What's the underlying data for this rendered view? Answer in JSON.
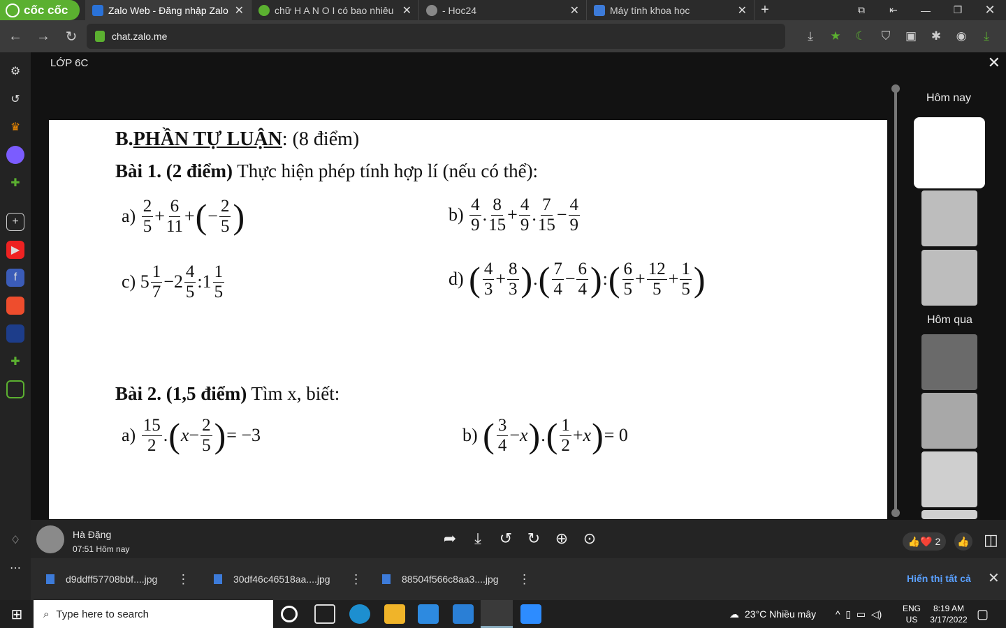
{
  "browser": {
    "brand": "cốc cốc",
    "tabs": [
      {
        "title": "Zalo Web - Đăng nhập Zalo",
        "active": true,
        "icon": "zalo-icon"
      },
      {
        "title": "chữ H A N O I có bao nhiêu",
        "active": false,
        "icon": "hoc24-icon"
      },
      {
        "title": "- Hoc24",
        "active": false,
        "icon": "globe-icon"
      },
      {
        "title": "Máy tính khoa học",
        "active": false,
        "icon": "calculator-icon"
      }
    ],
    "url": "chat.zalo.me"
  },
  "viewer": {
    "title": "LỚP 6C",
    "day_labels": [
      "Hôm nay",
      "Hôm qua"
    ],
    "sender": {
      "name": "Hà Đặng",
      "time": "07:51 Hôm nay"
    },
    "reaction_count": "2"
  },
  "document": {
    "heading_prefix": "B.",
    "heading_main": "PHẦN TỰ LUẬN",
    "heading_suffix": ": (8 điểm)",
    "bai1_label": "Bài 1",
    "bai1_points": ". (2 điểm)",
    "bai1_text": " Thực hiện phép tính hợp lí (nếu có thể):",
    "bai2_label": "Bài 2. (1,5 điểm)",
    "bai2_text": " Tìm x, biết:",
    "labels": {
      "a": "a)",
      "b": "b)",
      "c": "c)",
      "d": "d)"
    },
    "b2_rhs_a": "= −3",
    "b2_rhs_b": "= 0"
  },
  "downloads": {
    "files": [
      "d9ddff57708bbf....jpg",
      "30df46c46518aa....jpg",
      "88504f566c8aa3....jpg"
    ],
    "show_all": "Hiển thị tất cả"
  },
  "taskbar": {
    "search_placeholder": "Type here to search",
    "weather": "23°C  Nhiều mây",
    "lang": "ENG",
    "region": "US",
    "time": "8:19 AM",
    "date": "3/17/2022"
  }
}
